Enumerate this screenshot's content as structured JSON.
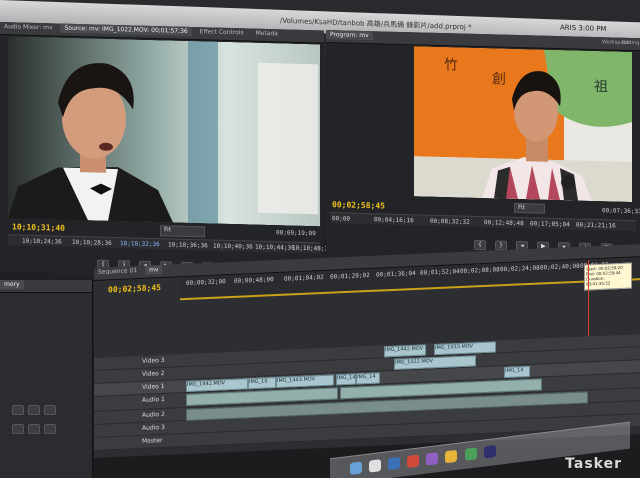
{
  "menubar": {
    "path": "/Volumes/KsaHD/tanbob 高雄/兵馬俑 錄影片/add.prproj *",
    "clock": "ARIS 3:00 PM"
  },
  "source_panel": {
    "tabs": [
      "Audio Mixer: mv",
      "Source: mv: IMG_1022.MOV: 00;01;57;36",
      "Effect Controls",
      "Metada"
    ],
    "timecode_current": "10;10;31;40",
    "timecode_duration": "00;00;19;09",
    "fit": "Fit",
    "ruler": [
      "10;10;24;36",
      "10;10;28;36",
      "10;10;32;36",
      "10;10;36;36",
      "10;10;40;36",
      "10;10;44;36",
      "10;10;48;36"
    ]
  },
  "program_panel": {
    "tab": "Program: mv",
    "workspace": [
      "Workspace:",
      "Editing"
    ],
    "timecode_current": "00;02;58;45",
    "timecode_duration": "00;07;36;33",
    "fit": "Fit",
    "ruler": [
      "00;00",
      "00;04;16;16",
      "00;08;32;32",
      "00;12;48;48",
      "00;17;05;04",
      "00;21;21;16"
    ]
  },
  "sequence_panel": {
    "project_tab": "mory",
    "tabs": [
      "Sequence 01",
      "mv"
    ],
    "timecode": "00;02;58;45",
    "ruler": [
      "00;00;32;00",
      "00;00;48;00",
      "00;01;04;02",
      "00;01;20;02",
      "00;01;36;04",
      "00;01;52;04",
      "00;02;08;08",
      "00;02;24;08",
      "00;02;40;08",
      "00;02;56"
    ],
    "tooltip": [
      "Start: 00;02;50;20",
      "End: 00;02;59;44",
      "Duration: 00;01;35;52"
    ],
    "tracks": [
      "Video 3",
      "Video 2",
      "Video 1",
      "Audio 1",
      "Audio 2",
      "Audio 3",
      "Master"
    ],
    "clips": [
      "IMG_1442.MOV",
      "IMG_10",
      "IMG_1443.MOV",
      "IMG_1442.MOV",
      "IMG_14",
      "IMG_14",
      "IMG_14",
      "IMG_1442.MOV",
      "IMG_1033.MOV",
      "IMG_1022.MOV"
    ]
  },
  "watermark": "Tasker",
  "colors": {
    "timecode": "#f0c21e",
    "clip": "#a9c6cf",
    "audio": "#93b0ad",
    "playhead": "#d8402f"
  }
}
